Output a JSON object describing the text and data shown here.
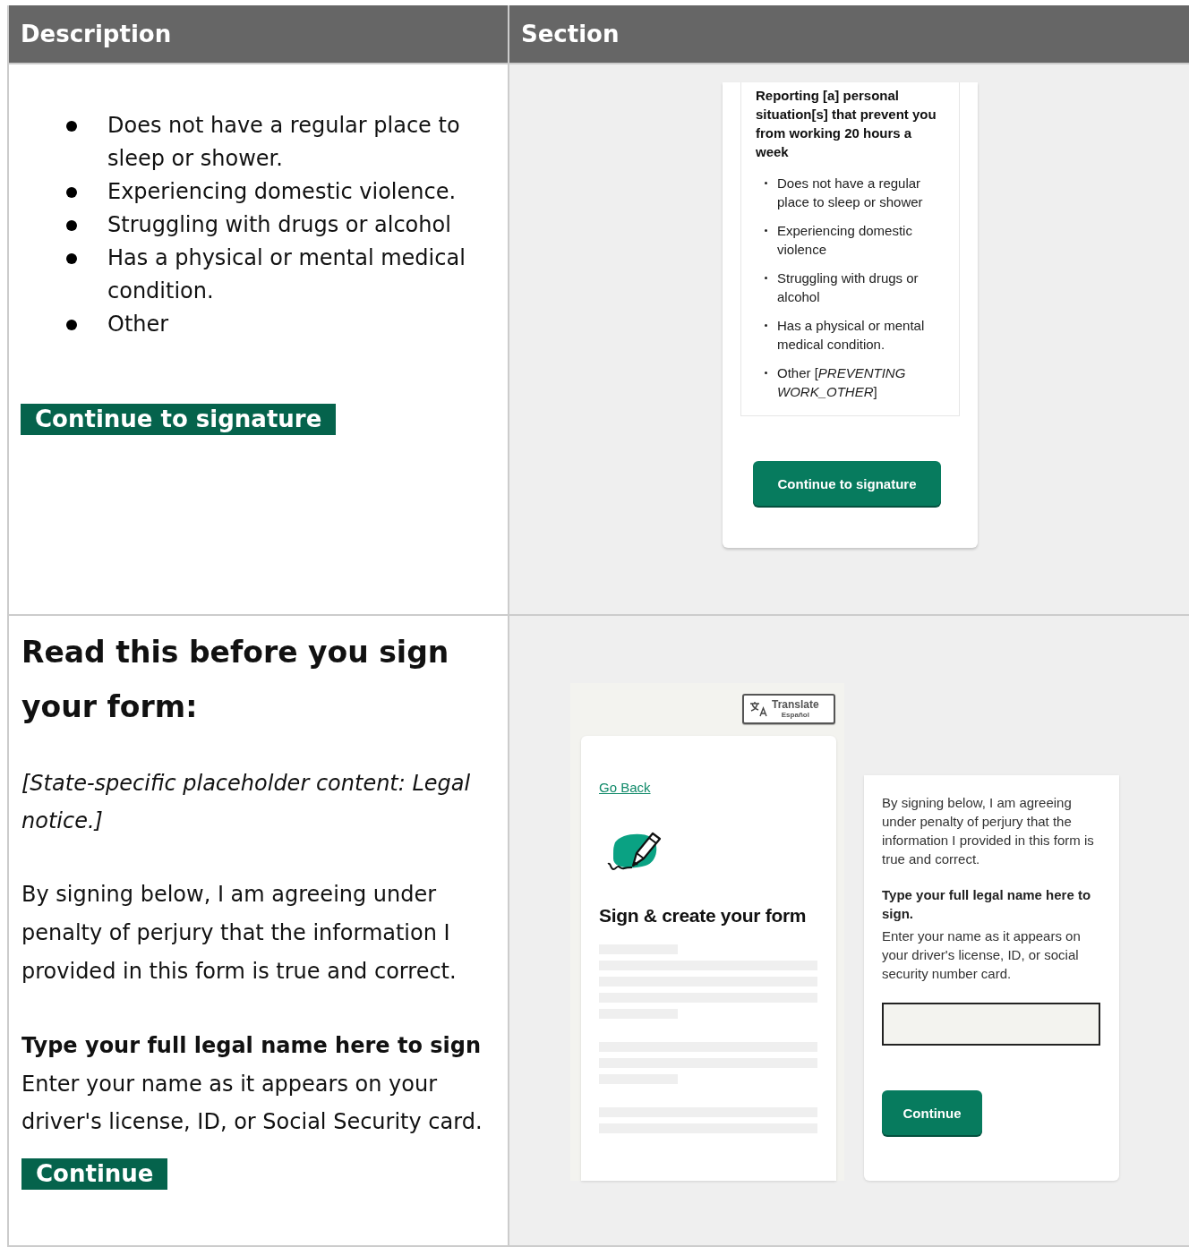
{
  "table": {
    "columns": [
      "Description",
      "Section"
    ],
    "rows": [
      {
        "description": {
          "kind": "list",
          "items": [
            "Does not have a regular place to sleep or shower.",
            "Experiencing domestic violence.",
            "Struggling with drugs or alcohol",
            "Has a physical or mental medical condition.",
            "Other"
          ],
          "button": "Continue to signature"
        },
        "section": {
          "kind": "situation",
          "heading": "Reporting [a] personal situation[s] that prevent you from working 20 hours a week",
          "items": [
            "Does not have a regular place to sleep or shower",
            "Experiencing domestic violence",
            "Struggling with drugs or alcohol",
            "Has a physical or mental medical condition.",
            "Other [*PREVENTING WORK_OTHER*]"
          ],
          "button": "Continue to signature"
        }
      },
      {
        "description": {
          "kind": "sign",
          "heading": "Read this before you sign your form:",
          "notice": "[State-specific placeholder content: Legal notice.]",
          "agreement": "By signing below, I am agreeing under penalty of perjury that the information I provided in this form is true and correct.",
          "label": "Type your full legal name here to sign",
          "hint": "Enter your name as it appears on your driver's license, ID, or Social Security card.",
          "button": "Continue"
        },
        "section": {
          "kind": "sign",
          "translate": {
            "label": "Translate",
            "sublabel": "Español"
          },
          "link": "Go Back",
          "title": "Sign & create your form",
          "agreement": "By signing below, I am agreeing under penalty of perjury that the information I provided in this form is true and correct.",
          "label": "Type your full legal name here to sign.",
          "hint": "Enter your name as it appears on your driver's license, ID, or social security number card.",
          "button": "Continue"
        }
      }
    ]
  }
}
